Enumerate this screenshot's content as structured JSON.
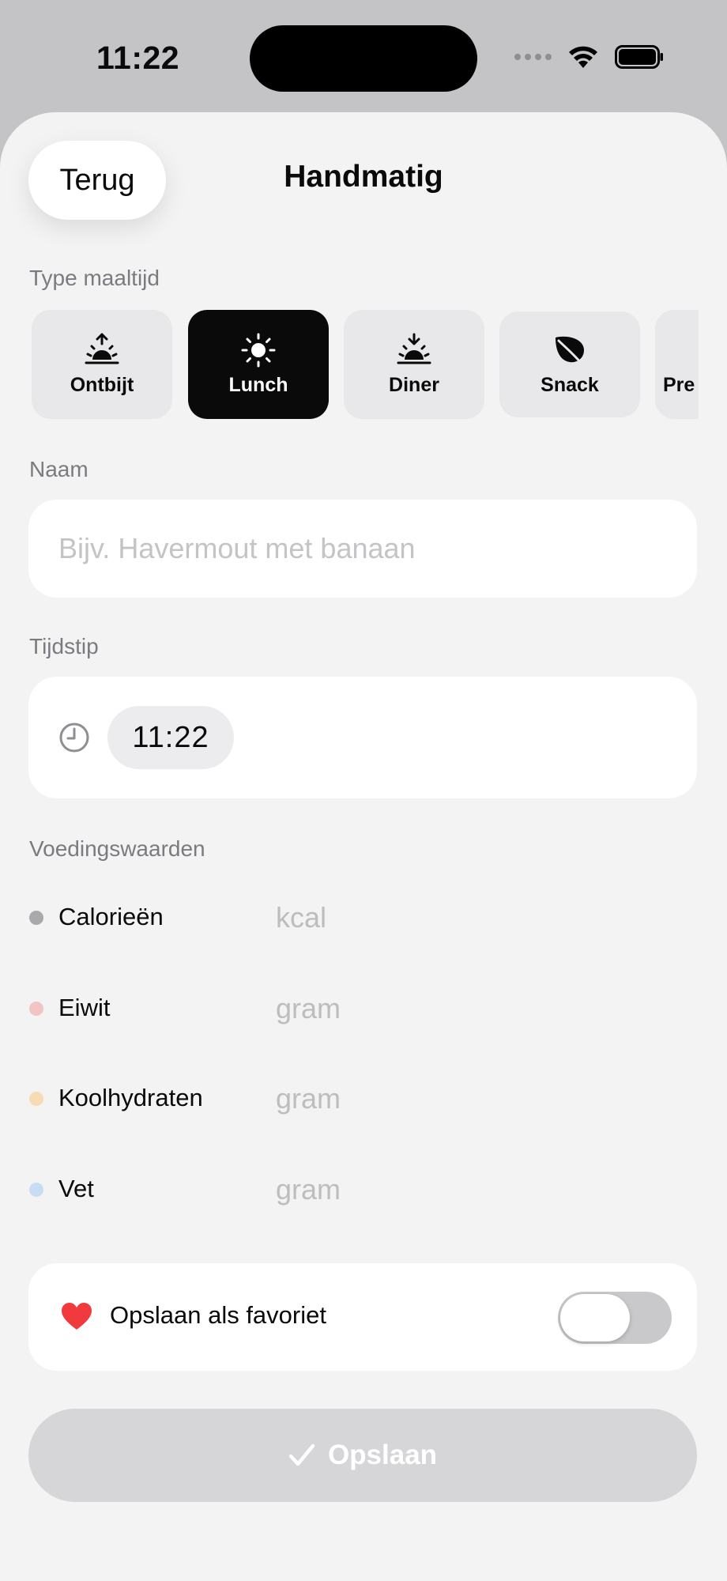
{
  "status_bar": {
    "time": "11:22"
  },
  "header": {
    "back_label": "Terug",
    "title": "Handmatig"
  },
  "meal_type": {
    "label": "Type maaltijd",
    "selected": "Lunch",
    "options": [
      {
        "label": "Ontbijt",
        "icon": "sunrise-icon"
      },
      {
        "label": "Lunch",
        "icon": "sun-icon"
      },
      {
        "label": "Diner",
        "icon": "sunset-icon"
      },
      {
        "label": "Snack",
        "icon": "leaf-icon"
      },
      {
        "label": "Pre",
        "icon": ""
      }
    ]
  },
  "name": {
    "label": "Naam",
    "placeholder": "Bijv. Havermout met banaan",
    "value": ""
  },
  "time": {
    "label": "Tijdstip",
    "value": "11:22",
    "icon": "clock-icon"
  },
  "nutrition": {
    "label": "Voedingswaarden",
    "rows": [
      {
        "label": "Calorieën",
        "unit": "kcal",
        "color": "#a9a9ab"
      },
      {
        "label": "Eiwit",
        "unit": "gram",
        "color": "#f2c4c4"
      },
      {
        "label": "Koolhydraten",
        "unit": "gram",
        "color": "#f5dcb4"
      },
      {
        "label": "Vet",
        "unit": "gram",
        "color": "#c8dcf4"
      }
    ]
  },
  "favorite": {
    "label": "Opslaan als favoriet",
    "enabled": false,
    "heart_color": "#f03a3e"
  },
  "save": {
    "label": "Opslaan",
    "disabled": true
  }
}
